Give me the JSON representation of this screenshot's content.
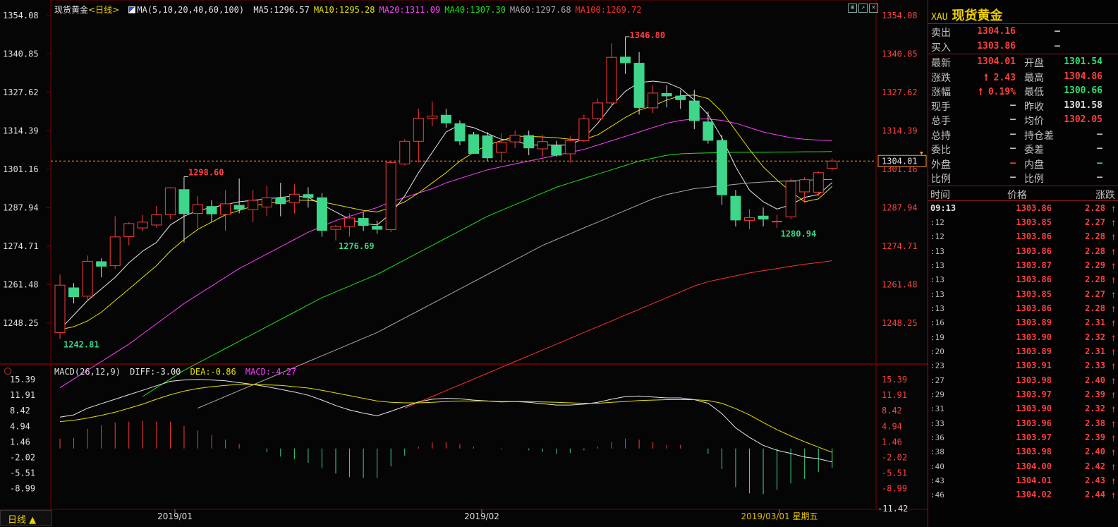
{
  "chart": {
    "title": "现货黄金",
    "period": "<日线>",
    "ma_label": "MA(5,10,20,40,60,100)",
    "ma": [
      {
        "label": "MA5:1296.57",
        "color": "#e8e8e8"
      },
      {
        "label": "MA10:1295.28",
        "color": "#e8e000"
      },
      {
        "label": "MA20:1311.09",
        "color": "#ff40ff"
      },
      {
        "label": "MA40:1307.30",
        "color": "#20e020"
      },
      {
        "label": "MA60:1297.68",
        "color": "#a8a8a8"
      },
      {
        "label": "MA100:1269.72",
        "color": "#ff3030"
      }
    ],
    "macd_label": "MACD(26,12,9)",
    "diff_label": "DIFF:-3.00",
    "dea_label": "DEA:-0.86",
    "macd_value_label": "MACD:-4.27",
    "price_axis": [
      "1354.08",
      "1340.85",
      "1327.62",
      "1314.39",
      "1301.16",
      "1287.94",
      "1274.71",
      "1261.48",
      "1248.25"
    ],
    "macd_axis": [
      "15.39",
      "11.91",
      "8.42",
      "4.94",
      "1.46",
      "-2.02",
      "-5.51",
      "-8.99"
    ],
    "macd_axis_right_extra": "-11.42",
    "current_price_tag": "1304.01",
    "annotations": {
      "high": "1346.80",
      "low_start": "1242.81",
      "peak1": "1298.60",
      "trough1": "1276.69",
      "trough2": "1280.94"
    },
    "dates": [
      "2019/01",
      "2019/02",
      "2019/03/01 星期五"
    ],
    "period_tab": "日线 ▲",
    "colors": {
      "up": "#ff3b3b",
      "down": "#3ed68a",
      "bg": "#050505",
      "grid": "#7a0000"
    }
  },
  "chart_data": {
    "type": "candlestick",
    "ylim": [
      1235,
      1360
    ],
    "candles": [
      {
        "o": 1245.0,
        "h": 1265.0,
        "l": 1242.8,
        "c": 1261.3
      },
      {
        "o": 1260.5,
        "h": 1262.0,
        "l": 1255.0,
        "c": 1257.2
      },
      {
        "o": 1257.5,
        "h": 1271.5,
        "l": 1256.0,
        "c": 1269.5
      },
      {
        "o": 1269.5,
        "h": 1270.5,
        "l": 1264.0,
        "c": 1267.7
      },
      {
        "o": 1268.0,
        "h": 1285.0,
        "l": 1267.0,
        "c": 1277.9
      },
      {
        "o": 1278.0,
        "h": 1283.0,
        "l": 1275.0,
        "c": 1282.5
      },
      {
        "o": 1281.0,
        "h": 1285.5,
        "l": 1280.0,
        "c": 1283.0
      },
      {
        "o": 1282.0,
        "h": 1288.5,
        "l": 1281.0,
        "c": 1285.5
      },
      {
        "o": 1285.5,
        "h": 1295.0,
        "l": 1284.0,
        "c": 1294.8
      },
      {
        "o": 1294.3,
        "h": 1298.6,
        "l": 1276.0,
        "c": 1285.8
      },
      {
        "o": 1286.0,
        "h": 1292.0,
        "l": 1281.0,
        "c": 1289.0
      },
      {
        "o": 1288.5,
        "h": 1290.5,
        "l": 1283.0,
        "c": 1285.7
      },
      {
        "o": 1285.7,
        "h": 1294.0,
        "l": 1280.0,
        "c": 1289.3
      },
      {
        "o": 1288.9,
        "h": 1298.0,
        "l": 1286.0,
        "c": 1287.3
      },
      {
        "o": 1287.3,
        "h": 1294.0,
        "l": 1283.0,
        "c": 1290.5
      },
      {
        "o": 1288.2,
        "h": 1295.5,
        "l": 1285.0,
        "c": 1291.4
      },
      {
        "o": 1291.4,
        "h": 1296.5,
        "l": 1285.0,
        "c": 1289.2
      },
      {
        "o": 1289.7,
        "h": 1296.0,
        "l": 1286.0,
        "c": 1292.6
      },
      {
        "o": 1292.6,
        "h": 1295.0,
        "l": 1288.0,
        "c": 1291.3
      },
      {
        "o": 1291.5,
        "h": 1293.0,
        "l": 1278.0,
        "c": 1280.0
      },
      {
        "o": 1280.5,
        "h": 1282.0,
        "l": 1276.7,
        "c": 1281.5
      },
      {
        "o": 1281.5,
        "h": 1286.0,
        "l": 1278.0,
        "c": 1284.4
      },
      {
        "o": 1284.4,
        "h": 1286.5,
        "l": 1280.0,
        "c": 1281.7
      },
      {
        "o": 1281.7,
        "h": 1283.5,
        "l": 1279.0,
        "c": 1280.4
      },
      {
        "o": 1280.4,
        "h": 1304.0,
        "l": 1279.5,
        "c": 1303.5
      },
      {
        "o": 1303.0,
        "h": 1311.5,
        "l": 1302.5,
        "c": 1310.8
      },
      {
        "o": 1310.8,
        "h": 1322.0,
        "l": 1303.5,
        "c": 1318.7
      },
      {
        "o": 1318.7,
        "h": 1324.5,
        "l": 1316.0,
        "c": 1319.5
      },
      {
        "o": 1319.9,
        "h": 1322.0,
        "l": 1315.5,
        "c": 1317.0
      },
      {
        "o": 1317.0,
        "h": 1318.0,
        "l": 1309.5,
        "c": 1310.8
      },
      {
        "o": 1313.2,
        "h": 1314.0,
        "l": 1308.0,
        "c": 1306.5
      },
      {
        "o": 1312.8,
        "h": 1314.0,
        "l": 1304.0,
        "c": 1305.0
      },
      {
        "o": 1307.0,
        "h": 1313.5,
        "l": 1303.5,
        "c": 1310.5
      },
      {
        "o": 1310.6,
        "h": 1314.5,
        "l": 1308.5,
        "c": 1312.9
      },
      {
        "o": 1312.9,
        "h": 1314.5,
        "l": 1306.0,
        "c": 1308.4
      },
      {
        "o": 1308.2,
        "h": 1313.0,
        "l": 1305.5,
        "c": 1310.7
      },
      {
        "o": 1309.4,
        "h": 1311.0,
        "l": 1305.5,
        "c": 1305.9
      },
      {
        "o": 1306.5,
        "h": 1312.5,
        "l": 1303.5,
        "c": 1311.0
      },
      {
        "o": 1311.0,
        "h": 1320.0,
        "l": 1310.5,
        "c": 1318.5
      },
      {
        "o": 1318.6,
        "h": 1325.5,
        "l": 1318.0,
        "c": 1324.0
      },
      {
        "o": 1324.0,
        "h": 1344.5,
        "l": 1323.0,
        "c": 1339.7
      },
      {
        "o": 1339.9,
        "h": 1346.8,
        "l": 1334.0,
        "c": 1337.7
      },
      {
        "o": 1337.8,
        "h": 1341.5,
        "l": 1320.0,
        "c": 1322.3
      },
      {
        "o": 1322.3,
        "h": 1330.0,
        "l": 1320.5,
        "c": 1327.4
      },
      {
        "o": 1327.4,
        "h": 1330.0,
        "l": 1322.5,
        "c": 1326.3
      },
      {
        "o": 1326.5,
        "h": 1328.5,
        "l": 1322.0,
        "c": 1325.0
      },
      {
        "o": 1324.8,
        "h": 1328.5,
        "l": 1315.0,
        "c": 1317.8
      },
      {
        "o": 1317.6,
        "h": 1321.0,
        "l": 1310.0,
        "c": 1311.0
      },
      {
        "o": 1311.2,
        "h": 1313.0,
        "l": 1289.0,
        "c": 1292.3
      },
      {
        "o": 1292.0,
        "h": 1294.0,
        "l": 1281.5,
        "c": 1283.6
      },
      {
        "o": 1283.6,
        "h": 1287.5,
        "l": 1280.5,
        "c": 1284.5
      },
      {
        "o": 1285.2,
        "h": 1288.0,
        "l": 1281.5,
        "c": 1283.9
      },
      {
        "o": 1283.2,
        "h": 1285.5,
        "l": 1280.9,
        "c": 1283.3
      },
      {
        "o": 1284.8,
        "h": 1298.0,
        "l": 1284.0,
        "c": 1297.0
      },
      {
        "o": 1293.4,
        "h": 1298.5,
        "l": 1289.5,
        "c": 1297.6
      },
      {
        "o": 1293.3,
        "h": 1300.5,
        "l": 1292.0,
        "c": 1300.0
      },
      {
        "o": 1301.5,
        "h": 1304.9,
        "l": 1300.7,
        "c": 1304.0
      }
    ],
    "ma5": [
      1246,
      1251,
      1256,
      1260,
      1264,
      1269,
      1273,
      1276,
      1282,
      1285,
      1287,
      1288,
      1289,
      1290,
      1290.5,
      1291,
      1291.5,
      1292,
      1291.5,
      1289,
      1286.5,
      1284,
      1282.5,
      1282,
      1286,
      1292,
      1300,
      1307,
      1314,
      1316.5,
      1315.5,
      1313.5,
      1311.5,
      1311,
      1309.5,
      1309.5,
      1309.5,
      1309.5,
      1312,
      1317,
      1323,
      1328,
      1331,
      1331.5,
      1331,
      1329,
      1325,
      1320,
      1312,
      1302,
      1294,
      1290,
      1287.5,
      1289,
      1291.5,
      1292.5,
      1296.6
    ],
    "ma10": [
      1246,
      1247,
      1249,
      1252,
      1256,
      1260,
      1264,
      1268,
      1273,
      1277,
      1280.5,
      1283,
      1285.5,
      1287,
      1288.5,
      1289.5,
      1290,
      1290.5,
      1290.5,
      1290,
      1289,
      1288,
      1287,
      1286.5,
      1288,
      1290,
      1293,
      1296.5,
      1300,
      1304,
      1307,
      1309.5,
      1311,
      1312.5,
      1312.5,
      1312.3,
      1312,
      1311.5,
      1311.5,
      1313,
      1316,
      1319,
      1321.5,
      1323,
      1325,
      1326.5,
      1326.7,
      1325.5,
      1321,
      1314.5,
      1308,
      1302,
      1297.5,
      1293.5,
      1290,
      1291,
      1295.3
    ],
    "ma20": [
      1226,
      1229,
      1232,
      1235,
      1238,
      1241,
      1244.5,
      1248,
      1251.5,
      1255,
      1258,
      1261,
      1264,
      1267,
      1269.5,
      1272,
      1274.5,
      1277,
      1279.5,
      1281.5,
      1283.5,
      1285,
      1286.5,
      1288,
      1290,
      1291.5,
      1293,
      1294.5,
      1296.5,
      1298,
      1299.5,
      1301,
      1302,
      1303,
      1304,
      1305,
      1306,
      1307,
      1308,
      1309.5,
      1311,
      1312.5,
      1314,
      1315.5,
      1317,
      1318,
      1318.5,
      1318.5,
      1318,
      1317,
      1315.5,
      1314,
      1313,
      1312,
      1311.5,
      1311.2,
      1311.1
    ],
    "ma40": [
      null,
      null,
      null,
      null,
      null,
      null,
      1223,
      1226,
      1229,
      1232,
      1234.5,
      1237,
      1239.5,
      1242,
      1244.5,
      1247,
      1249.5,
      1252,
      1254.5,
      1257,
      1259,
      1261,
      1263,
      1265,
      1267.5,
      1270,
      1272.5,
      1275,
      1277.5,
      1280,
      1282.5,
      1285,
      1287,
      1289,
      1291,
      1293,
      1295,
      1296.5,
      1298,
      1299.5,
      1301,
      1302.5,
      1304,
      1305,
      1306,
      1306.5,
      1306.7,
      1306.8,
      1306.9,
      1307,
      1307,
      1307,
      1307.1,
      1307.1,
      1307.2,
      1307.2,
      1307.3
    ],
    "ma60": [
      null,
      null,
      null,
      null,
      null,
      null,
      null,
      null,
      null,
      null,
      1219,
      1221,
      1223,
      1225,
      1227,
      1229,
      1231,
      1233,
      1235,
      1237,
      1239,
      1241,
      1243,
      1245,
      1247.5,
      1250,
      1252.5,
      1255,
      1257.5,
      1260,
      1262.5,
      1265,
      1267.5,
      1270,
      1272.5,
      1275,
      1277,
      1279,
      1281,
      1283,
      1285,
      1287,
      1289,
      1291,
      1292.5,
      1293.5,
      1294.5,
      1295,
      1295.5,
      1296,
      1296.5,
      1296.8,
      1297,
      1297.2,
      1297.4,
      1297.6,
      1297.7
    ],
    "ma100": [
      null,
      null,
      null,
      null,
      null,
      null,
      null,
      null,
      null,
      null,
      null,
      null,
      null,
      null,
      null,
      null,
      null,
      null,
      null,
      null,
      null,
      null,
      null,
      null,
      null,
      1219,
      1221,
      1223,
      1225,
      1227,
      1229,
      1231,
      1233,
      1235,
      1237,
      1239,
      1241,
      1243,
      1245,
      1247,
      1249,
      1251,
      1253,
      1255,
      1257,
      1259,
      1261,
      1262.5,
      1263.5,
      1264.5,
      1265.5,
      1266.3,
      1267,
      1267.8,
      1268.5,
      1269.1,
      1269.7
    ],
    "diff": [
      7,
      7.5,
      9,
      10,
      11,
      12,
      13,
      14,
      15,
      15.3,
      15.4,
      15.3,
      15.1,
      14.7,
      14.3,
      13.8,
      13.2,
      12.6,
      11.9,
      10.8,
      9.6,
      8.6,
      7.9,
      7.3,
      8.3,
      9.4,
      10.4,
      11,
      11.2,
      11.1,
      10.8,
      10.6,
      10.4,
      10.5,
      10.3,
      10,
      9.7,
      9.7,
      9.9,
      10.3,
      11,
      11.6,
      11.7,
      11.5,
      11.3,
      11.3,
      10.9,
      10.1,
      7.8,
      4.6,
      2.5,
      0.7,
      -0.4,
      -1.1,
      -1.9,
      -2.3,
      -3.0
    ],
    "dea": [
      6,
      6.3,
      6.8,
      7.4,
      8.1,
      9,
      9.9,
      11,
      12,
      12.8,
      13.4,
      13.8,
      14.1,
      14.3,
      14.3,
      14.2,
      14.1,
      13.8,
      13.5,
      13,
      12.4,
      11.8,
      11.2,
      10.6,
      10.3,
      10.2,
      10.2,
      10.3,
      10.5,
      10.6,
      10.6,
      10.6,
      10.5,
      10.5,
      10.5,
      10.4,
      10.3,
      10.2,
      10.1,
      10.1,
      10.3,
      10.5,
      10.7,
      10.8,
      10.9,
      10.9,
      10.9,
      10.7,
      10.1,
      8.9,
      7.5,
      5.8,
      4.2,
      2.8,
      1.5,
      0.3,
      -0.86
    ],
    "macd": [
      2.2,
      2.4,
      4.4,
      5.2,
      5.8,
      6.0,
      6.2,
      6.0,
      6.0,
      5.0,
      4.0,
      3.0,
      2.0,
      1.0,
      0.0,
      -0.8,
      -1.8,
      -2.4,
      -3.2,
      -4.4,
      -5.6,
      -6.4,
      -6.6,
      -6.6,
      -4.0,
      -1.6,
      0.4,
      1.4,
      1.4,
      1.0,
      0.4,
      0.0,
      -0.2,
      0.0,
      -0.4,
      -0.8,
      -1.2,
      -1.0,
      -0.4,
      0.4,
      1.4,
      2.2,
      2.0,
      1.4,
      0.8,
      0.8,
      0.0,
      -1.2,
      -4.6,
      -8.6,
      -10.0,
      -10.2,
      -9.2,
      -7.8,
      -6.8,
      -5.2,
      -4.27
    ]
  },
  "side": {
    "code": "XAU",
    "name": "现货黄金",
    "bid_ask": [
      {
        "label": "卖出",
        "value": "1304.16",
        "value2": "–"
      },
      {
        "label": "买入",
        "value": "1303.86",
        "value2": "–"
      }
    ],
    "quote_rows": [
      {
        "l1": "最新",
        "v1": "1304.01",
        "c1": "#ff4040",
        "l2": "开盘",
        "v2": "1301.54",
        "c2": "#30e070"
      },
      {
        "l1": "涨跌",
        "v1": "🠕 2.43",
        "c1": "#ff4040",
        "l2": "最高",
        "v2": "1304.86",
        "c2": "#ff4040"
      },
      {
        "l1": "涨幅",
        "v1": "🠕 0.19%",
        "c1": "#ff4040",
        "l2": "最低",
        "v2": "1300.66",
        "c2": "#30e070"
      },
      {
        "l1": "现手",
        "v1": "–",
        "c1": "#c0c0c0",
        "l2": "昨收",
        "v2": "1301.58",
        "c2": "#e0e0e0"
      },
      {
        "l1": "总手",
        "v1": "–",
        "c1": "#c0c0c0",
        "l2": "均价",
        "v2": "1302.05",
        "c2": "#ff4040"
      },
      {
        "l1": "总持",
        "v1": "–",
        "c1": "#c0c0c0",
        "l2": "持仓差",
        "v2": "–",
        "c2": "#c0c0c0"
      },
      {
        "l1": "委比",
        "v1": "–",
        "c1": "#c0c0c0",
        "l2": "委差",
        "v2": "–",
        "c2": "#c0c0c0"
      },
      {
        "l1": "外盘",
        "v1": "–",
        "c1": "#ff4040",
        "l2": "内盘",
        "v2": "–",
        "c2": "#30e070"
      },
      {
        "l1": "比例",
        "v1": "–",
        "c1": "#c0c0c0",
        "l2": "比例",
        "v2": "–",
        "c2": "#c0c0c0"
      }
    ],
    "tick_headers": {
      "time": "时间",
      "price": "价格",
      "change": "涨跌"
    },
    "ticks": [
      {
        "t": "09:13",
        "p": "1303.86",
        "c": "2.28"
      },
      {
        "t": ":12",
        "p": "1303.85",
        "c": "2.27"
      },
      {
        "t": ":12",
        "p": "1303.86",
        "c": "2.28"
      },
      {
        "t": ":13",
        "p": "1303.86",
        "c": "2.28"
      },
      {
        "t": ":13",
        "p": "1303.87",
        "c": "2.29"
      },
      {
        "t": ":13",
        "p": "1303.86",
        "c": "2.28"
      },
      {
        "t": ":13",
        "p": "1303.85",
        "c": "2.27"
      },
      {
        "t": ":13",
        "p": "1303.86",
        "c": "2.28"
      },
      {
        "t": ":16",
        "p": "1303.89",
        "c": "2.31"
      },
      {
        "t": ":19",
        "p": "1303.90",
        "c": "2.32"
      },
      {
        "t": ":20",
        "p": "1303.89",
        "c": "2.31"
      },
      {
        "t": ":23",
        "p": "1303.91",
        "c": "2.33"
      },
      {
        "t": ":27",
        "p": "1303.98",
        "c": "2.40"
      },
      {
        "t": ":29",
        "p": "1303.97",
        "c": "2.39"
      },
      {
        "t": ":31",
        "p": "1303.90",
        "c": "2.32"
      },
      {
        "t": ":33",
        "p": "1303.96",
        "c": "2.38"
      },
      {
        "t": ":36",
        "p": "1303.97",
        "c": "2.39"
      },
      {
        "t": ":38",
        "p": "1303.98",
        "c": "2.40"
      },
      {
        "t": ":40",
        "p": "1304.00",
        "c": "2.42"
      },
      {
        "t": ":43",
        "p": "1304.01",
        "c": "2.43"
      },
      {
        "t": ":46",
        "p": "1304.02",
        "c": "2.44"
      }
    ],
    "tick_arrow": "🠕"
  }
}
